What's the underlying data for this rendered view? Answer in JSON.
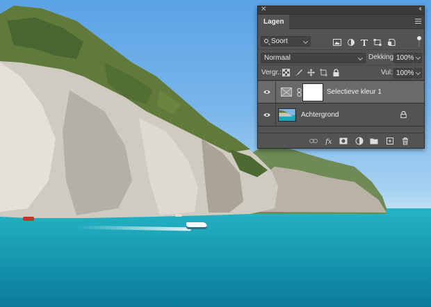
{
  "colors": {
    "panel_bg": "#535353",
    "selected_layer_bg": "#6a6a6a",
    "sea": "#1ea6bb",
    "sky": "#78b5ea"
  },
  "photo": {
    "description_icon": "coastal-cliff-photo"
  },
  "panel": {
    "tab_label": "Lagen",
    "filter": {
      "kind_label": "Soort",
      "icons": [
        "image-filter-icon",
        "adjustment-filter-icon",
        "type-filter-icon",
        "shape-filter-icon",
        "smartobject-filter-icon"
      ]
    },
    "blend": {
      "mode": "Normaal",
      "opacity_label": "Dekking:",
      "opacity_value": "100%"
    },
    "lock": {
      "label": "Vergr.:",
      "fill_label": "Vul:",
      "fill_value": "100%"
    },
    "layers": [
      {
        "name": "Selectieve kleur 1",
        "selected": true,
        "type": "adjustment"
      },
      {
        "name": "Achtergrond",
        "selected": false,
        "type": "background",
        "locked": true
      }
    ],
    "footer_icons": [
      "link-layers-icon",
      "fx-icon",
      "add-mask-icon",
      "new-adjustment-icon",
      "new-group-icon",
      "new-layer-icon",
      "delete-layer-icon"
    ]
  }
}
